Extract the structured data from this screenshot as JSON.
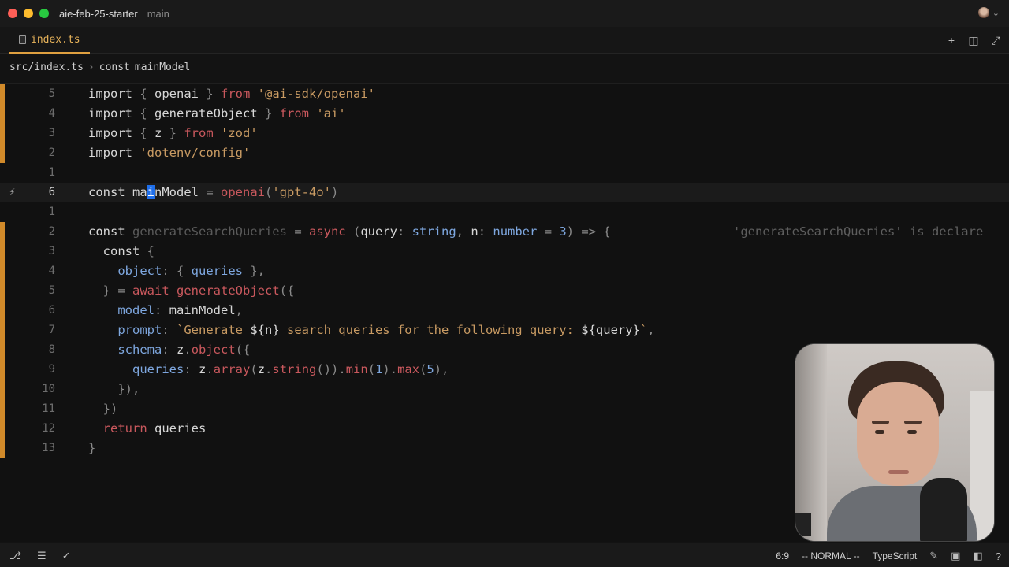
{
  "window": {
    "project": "aie-feb-25-starter",
    "branch": "main"
  },
  "tabs": [
    {
      "label": "index.ts"
    }
  ],
  "tab_actions": [
    "+",
    "◫",
    "⤢"
  ],
  "breadcrumb": {
    "file": "src/index.ts",
    "separator": "›",
    "keyword": "const",
    "symbol": "mainModel"
  },
  "editor": {
    "line_numbers": [
      "5",
      "4",
      "3",
      "2",
      "1",
      "6",
      "1",
      "2",
      "3",
      "4",
      "5",
      "6",
      "7",
      "8",
      "9",
      "10",
      "11",
      "12",
      "13"
    ],
    "current_line_index": 5,
    "diagnostic": "'generateSearchQueries' is declare",
    "lines": [
      [
        [
          "kw2",
          "import "
        ],
        [
          "punc",
          "{ "
        ],
        [
          "plain",
          "openai"
        ],
        [
          "punc",
          " } "
        ],
        [
          "kw",
          "from "
        ],
        [
          "str",
          "'@ai-sdk/openai'"
        ]
      ],
      [
        [
          "kw2",
          "import "
        ],
        [
          "punc",
          "{ "
        ],
        [
          "plain",
          "generateObject"
        ],
        [
          "punc",
          " } "
        ],
        [
          "kw",
          "from "
        ],
        [
          "str",
          "'ai'"
        ]
      ],
      [
        [
          "kw2",
          "import "
        ],
        [
          "punc",
          "{ "
        ],
        [
          "plain",
          "z"
        ],
        [
          "punc",
          " } "
        ],
        [
          "kw",
          "from "
        ],
        [
          "str",
          "'zod'"
        ]
      ],
      [
        [
          "kw2",
          "import "
        ],
        [
          "str",
          "'dotenv/config'"
        ]
      ],
      [],
      [
        [
          "kw2",
          "const "
        ],
        [
          "plain",
          "ma"
        ],
        [
          "cursor",
          "i"
        ],
        [
          "plain",
          "nModel "
        ],
        [
          "punc",
          "= "
        ],
        [
          "fn",
          "openai"
        ],
        [
          "punc",
          "("
        ],
        [
          "str",
          "'gpt-4o'"
        ],
        [
          "punc",
          ")"
        ]
      ],
      [],
      [
        [
          "kw2",
          "const "
        ],
        [
          "dim",
          "generateSearchQueries "
        ],
        [
          "punc",
          "= "
        ],
        [
          "kw",
          "async "
        ],
        [
          "punc",
          "("
        ],
        [
          "plain",
          "query"
        ],
        [
          "punc",
          ": "
        ],
        [
          "ty",
          "string"
        ],
        [
          "punc",
          ", "
        ],
        [
          "plain",
          "n"
        ],
        [
          "punc",
          ": "
        ],
        [
          "ty",
          "number "
        ],
        [
          "punc",
          "= "
        ],
        [
          "num",
          "3"
        ],
        [
          "punc",
          ") => {"
        ]
      ],
      [
        [
          "plain",
          "  "
        ],
        [
          "kw2",
          "const "
        ],
        [
          "punc",
          "{"
        ]
      ],
      [
        [
          "plain",
          "    "
        ],
        [
          "prop",
          "object"
        ],
        [
          "punc",
          ": { "
        ],
        [
          "prop",
          "queries "
        ],
        [
          "punc",
          "},"
        ]
      ],
      [
        [
          "plain",
          "  "
        ],
        [
          "punc",
          "} = "
        ],
        [
          "kw",
          "await "
        ],
        [
          "fn",
          "generateObject"
        ],
        [
          "punc",
          "({"
        ]
      ],
      [
        [
          "plain",
          "    "
        ],
        [
          "prop",
          "model"
        ],
        [
          "punc",
          ": "
        ],
        [
          "plain",
          "mainModel"
        ],
        [
          "punc",
          ","
        ]
      ],
      [
        [
          "plain",
          "    "
        ],
        [
          "prop",
          "prompt"
        ],
        [
          "punc",
          ": "
        ],
        [
          "tmpl",
          "`Generate "
        ],
        [
          "plain",
          "${n}"
        ],
        [
          "tmpl",
          " search queries for the following query: "
        ],
        [
          "plain",
          "${query}"
        ],
        [
          "tmpl",
          "`"
        ],
        [
          "punc",
          ","
        ]
      ],
      [
        [
          "plain",
          "    "
        ],
        [
          "prop",
          "schema"
        ],
        [
          "punc",
          ": "
        ],
        [
          "plain",
          "z"
        ],
        [
          "punc",
          "."
        ],
        [
          "fn",
          "object"
        ],
        [
          "punc",
          "({"
        ]
      ],
      [
        [
          "plain",
          "      "
        ],
        [
          "prop",
          "queries"
        ],
        [
          "punc",
          ": "
        ],
        [
          "plain",
          "z"
        ],
        [
          "punc",
          "."
        ],
        [
          "fn",
          "array"
        ],
        [
          "punc",
          "("
        ],
        [
          "plain",
          "z"
        ],
        [
          "punc",
          "."
        ],
        [
          "fn",
          "string"
        ],
        [
          "punc",
          "())."
        ],
        [
          "fn",
          "min"
        ],
        [
          "punc",
          "("
        ],
        [
          "num",
          "1"
        ],
        [
          "punc",
          ")."
        ],
        [
          "fn",
          "max"
        ],
        [
          "punc",
          "("
        ],
        [
          "num",
          "5"
        ],
        [
          "punc",
          "),"
        ]
      ],
      [
        [
          "plain",
          "    "
        ],
        [
          "punc",
          "}),"
        ]
      ],
      [
        [
          "plain",
          "  "
        ],
        [
          "punc",
          "})"
        ]
      ],
      [
        [
          "plain",
          "  "
        ],
        [
          "kw",
          "return "
        ],
        [
          "plain",
          "queries"
        ]
      ],
      [
        [
          "punc",
          "}"
        ]
      ]
    ]
  },
  "statusbar": {
    "position": "6:9",
    "mode": "-- NORMAL --",
    "language": "TypeScript"
  },
  "colors": {
    "accent": "#e0a040",
    "keyword": "#c9585d",
    "string": "#c99b63",
    "property": "#7ea7df",
    "modified_gutter": "#d18a2a"
  }
}
